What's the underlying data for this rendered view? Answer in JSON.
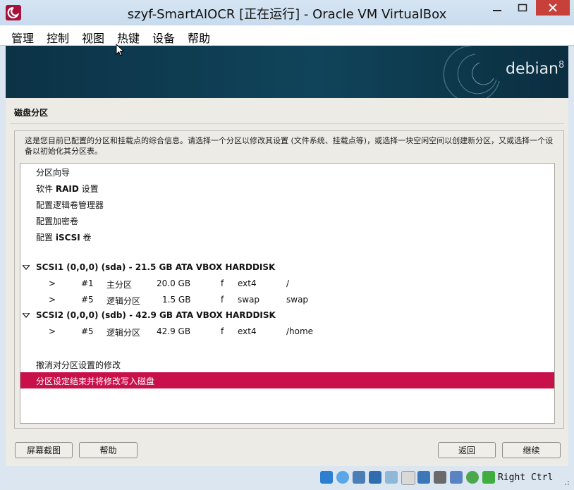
{
  "window": {
    "title": "szyf-SmartAIOCR [正在运行] - Oracle VM VirtualBox"
  },
  "menu": [
    "管理",
    "控制",
    "视图",
    "热键",
    "设备",
    "帮助"
  ],
  "banner": {
    "logo_text": "debian",
    "logo_version": "8"
  },
  "page": {
    "title": "磁盘分区",
    "description": "这是您目前已配置的分区和挂载点的综合信息。请选择一个分区以修改其设置 (文件系统、挂载点等)，或选择一块空闲空间以创建新分区，又或选择一个设备以初始化其分区表。"
  },
  "options": {
    "guided": "分区向导",
    "raid_prefix": "软件 ",
    "raid_bold": "RAID",
    "raid_suffix": " 设置",
    "lvm": "配置逻辑卷管理器",
    "crypto": "配置加密卷",
    "iscsi_prefix": "配置 ",
    "iscsi_bold": "iSCSI",
    "iscsi_suffix": " 卷"
  },
  "disks": [
    {
      "label": "SCSI1 (0,0,0) (sda) - 21.5 GB ATA VBOX HARDDISK",
      "partitions": [
        {
          "arrow": ">",
          "num": "#1",
          "type": "主分区",
          "size": "20.0 GB",
          "flag": "f",
          "fs": "ext4",
          "mount": "/"
        },
        {
          "arrow": ">",
          "num": "#5",
          "type": "逻辑分区",
          "size": "1.5 GB",
          "flag": "f",
          "fs": "swap",
          "mount": "swap"
        }
      ]
    },
    {
      "label": "SCSI2 (0,0,0) (sdb) - 42.9 GB ATA VBOX HARDDISK",
      "partitions": [
        {
          "arrow": ">",
          "num": "#5",
          "type": "逻辑分区",
          "size": "42.9 GB",
          "flag": "f",
          "fs": "ext4",
          "mount": "/home"
        }
      ]
    }
  ],
  "actions": {
    "undo": "撤消对分区设置的修改",
    "finish": "分区设定结束并将修改写入磁盘"
  },
  "buttons": {
    "screenshot": "屏幕截图",
    "help": "帮助",
    "back": "返回",
    "continue": "继续"
  },
  "statusbar": {
    "host_key": "Right Ctrl"
  },
  "colors": {
    "selection": "#c8104a",
    "banner": "#10445a",
    "close_button": "#c8403a"
  }
}
